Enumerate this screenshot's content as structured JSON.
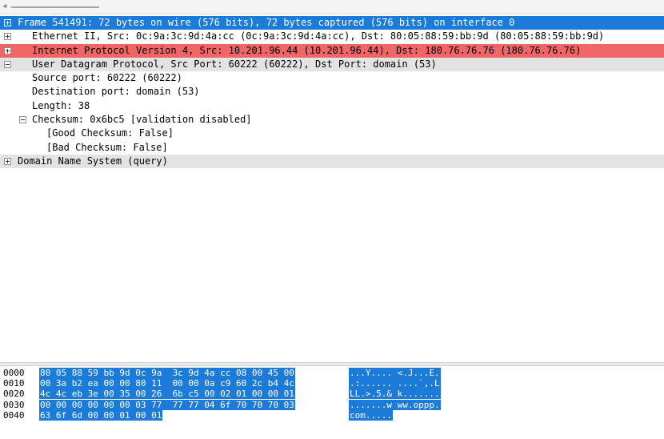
{
  "tree": {
    "rows": [
      {
        "text": "Frame 541491: 72 bytes on wire (576 bits), 72 bytes captured (576 bits) on interface 0",
        "toggle": "plus",
        "state": "selected"
      },
      {
        "text": "Ethernet II, Src: 0c:9a:3c:9d:4a:cc (0c:9a:3c:9d:4a:cc), Dst: 80:05:88:59:bb:9d (80:05:88:59:bb:9d)",
        "toggle": "plus",
        "state": "normal"
      },
      {
        "text": "Internet Protocol Version 4, Src: 10.201.96.44 (10.201.96.44), Dst: 180.76.76.76 (180.76.76.76)",
        "toggle": "plus",
        "state": "error"
      },
      {
        "text": "User Datagram Protocol, Src Port: 60222 (60222), Dst Port: domain (53)",
        "toggle": "minus",
        "state": "header"
      },
      {
        "text": "Source port: 60222 (60222)",
        "toggle": "none",
        "state": "normal"
      },
      {
        "text": "Destination port: domain (53)",
        "toggle": "none",
        "state": "normal"
      },
      {
        "text": "Length: 38",
        "toggle": "none",
        "state": "normal"
      },
      {
        "text": "Checksum: 0x6bc5 [validation disabled]",
        "toggle": "minus",
        "state": "normal"
      },
      {
        "text": "[Good Checksum: False]",
        "toggle": "none",
        "state": "normal"
      },
      {
        "text": "[Bad Checksum: False]",
        "toggle": "none",
        "state": "normal"
      },
      {
        "text": "Domain Name System (query)",
        "toggle": "plus",
        "state": "header"
      }
    ]
  },
  "hex": {
    "rows": [
      {
        "offset": "0000",
        "bytes": "80 05 88 59 bb 9d 0c 9a  3c 9d 4a cc 08 00 45 00",
        "ascii": "...Y.... <.J...E."
      },
      {
        "offset": "0010",
        "bytes": "00 3a b2 ea 00 00 80 11  00 00 0a c9 60 2c b4 4c",
        "ascii": ".:...... ....`,.L"
      },
      {
        "offset": "0020",
        "bytes": "4c 4c eb 3e 00 35 00 26  6b c5 00 02 01 00 00 01",
        "ascii": "LL.>.5.& k......."
      },
      {
        "offset": "0030",
        "bytes": "00 00 00 00 00 00 03 77  77 77 04 6f 70 70 70 03",
        "ascii": ".......w ww.oppp."
      },
      {
        "offset": "0040",
        "bytes": "63 6f 6d 00 00 01 00 01",
        "ascii": "com....."
      }
    ]
  },
  "colors": {
    "selected": "#1c7ad9",
    "error": "#f06565",
    "header": "#e3e3e3"
  }
}
